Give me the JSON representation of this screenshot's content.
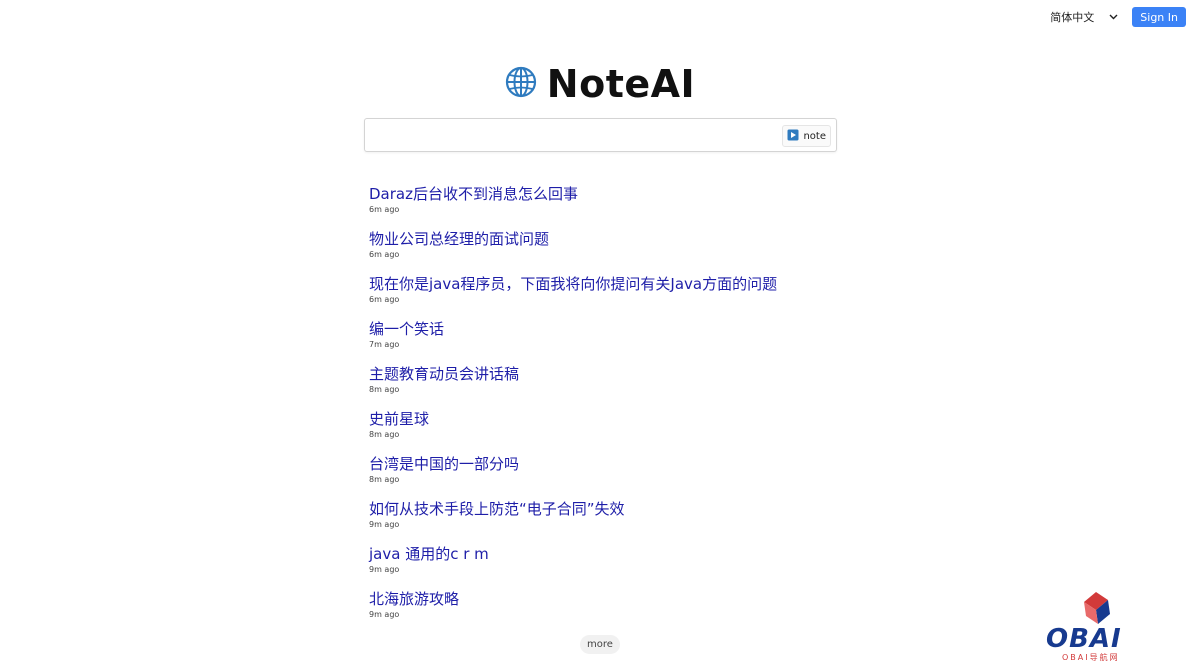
{
  "header": {
    "language_label": "简体中文",
    "sign_in_label": "Sign In"
  },
  "brand": {
    "name": "NoteAI",
    "icon": "globe-icon",
    "accent": "#3b82f6"
  },
  "search": {
    "value": "",
    "placeholder": "",
    "button_label": "note",
    "button_icon": "play-icon"
  },
  "history": [
    {
      "title": "Daraz后台收不到消息怎么回事",
      "time": "6m ago"
    },
    {
      "title": "物业公司总经理的面试问题",
      "time": "6m ago"
    },
    {
      "title": "现在你是java程序员，下面我将向你提问有关Java方面的问题",
      "time": "6m ago"
    },
    {
      "title": "编一个笑话",
      "time": "7m ago"
    },
    {
      "title": "主题教育动员会讲话稿",
      "time": "8m ago"
    },
    {
      "title": "史前星球",
      "time": "8m ago"
    },
    {
      "title": "台湾是中国的一部分吗",
      "time": "8m ago"
    },
    {
      "title": "如何从技术手段上防范“电子合同”失效",
      "time": "9m ago"
    },
    {
      "title": "java 通用的c r m",
      "time": "9m ago"
    },
    {
      "title": "北海旅游攻略",
      "time": "9m ago"
    }
  ],
  "more_label": "more",
  "watermark": {
    "logo_text": "OBAI",
    "sub_text": "OBAI导航网",
    "colors": {
      "red": "#d23a3a",
      "blue": "#173a8f"
    }
  },
  "link_color": "#1e1ea8"
}
